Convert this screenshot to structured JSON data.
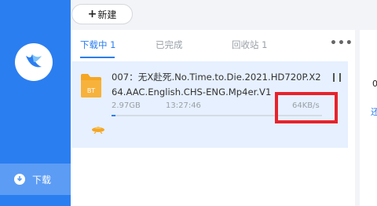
{
  "sidebar": {
    "nav": {
      "download_label": "下载"
    }
  },
  "toolbar": {
    "new_label": "新建",
    "new_plus": "+"
  },
  "tabs": [
    {
      "label": "下载中 1",
      "active": true
    },
    {
      "label": "已完成",
      "active": false
    },
    {
      "label": "回收站 1",
      "active": false
    }
  ],
  "more_label": "•••",
  "download": {
    "filename": "007：无X赴死.No.Time.to.Die.2021.HD720P.X264.AAC.English.CHS-ENG.Mp4er.V1",
    "file_icon_text": "BT",
    "size": "2.97GB",
    "eta": "13:27:46",
    "speed": "64KB/s",
    "progress": 0.02
  },
  "right_pane": {
    "char": "0",
    "link": "还"
  },
  "colors": {
    "accent": "#2b7ef0",
    "highlight": "#e8222a",
    "row_bg": "#e6f0fe"
  }
}
